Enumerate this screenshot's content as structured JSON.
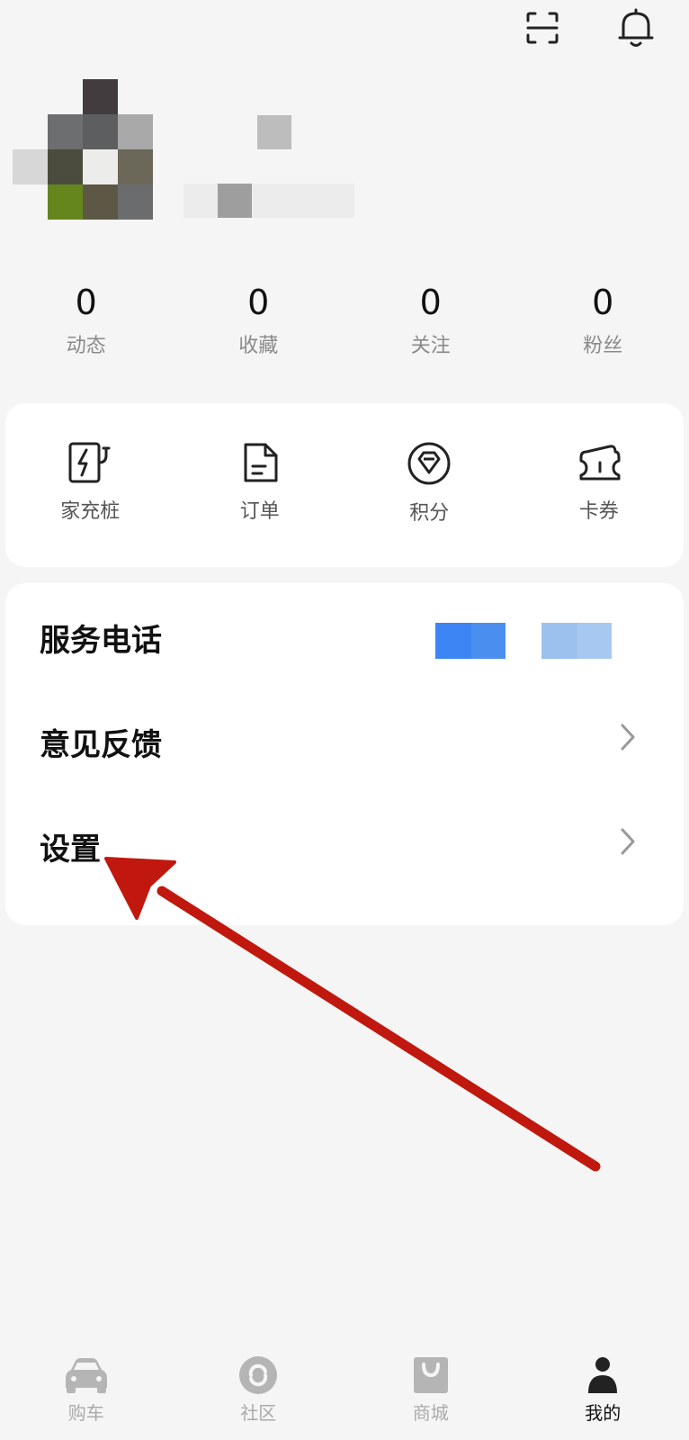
{
  "header": {
    "scan_icon": "scan-icon",
    "bell_icon": "bell-icon"
  },
  "stats": [
    {
      "value": "0",
      "label": "动态"
    },
    {
      "value": "0",
      "label": "收藏"
    },
    {
      "value": "0",
      "label": "关注"
    },
    {
      "value": "0",
      "label": "粉丝"
    }
  ],
  "quick_actions": [
    {
      "label": "家充桩",
      "icon": "charger-icon"
    },
    {
      "label": "订单",
      "icon": "order-icon"
    },
    {
      "label": "积分",
      "icon": "points-icon"
    },
    {
      "label": "卡券",
      "icon": "coupon-icon"
    }
  ],
  "menu": [
    {
      "label": "服务电话"
    },
    {
      "label": "意见反馈"
    },
    {
      "label": "设置"
    }
  ],
  "tabbar": [
    {
      "label": "购车",
      "icon": "car-icon"
    },
    {
      "label": "社区",
      "icon": "community-icon"
    },
    {
      "label": "商城",
      "icon": "shop-icon"
    },
    {
      "label": "我的",
      "icon": "profile-icon",
      "active": true
    }
  ],
  "colors": {
    "background": "#f5f5f5",
    "annotation_arrow": "#c0180e",
    "service_button_primary": "#3d85f5",
    "service_button_secondary": "#9cc1ef"
  }
}
